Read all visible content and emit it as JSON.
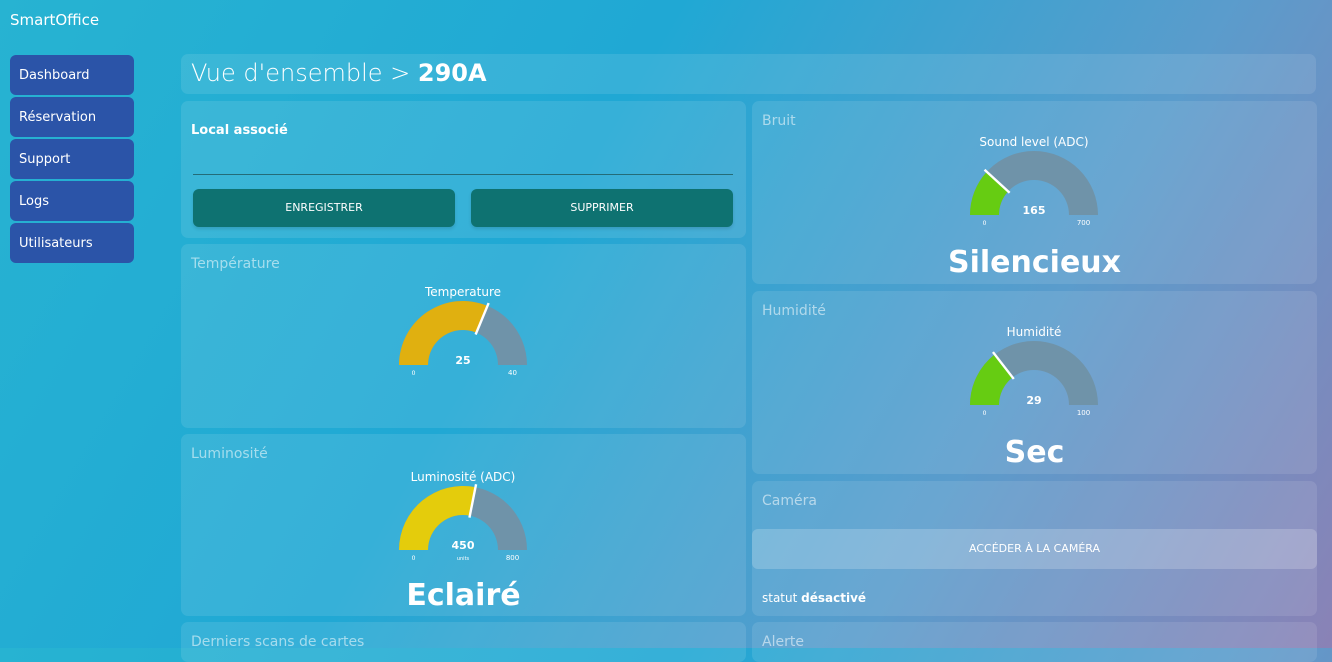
{
  "app": {
    "brand": "SmartOffice"
  },
  "sidebar": {
    "items": [
      {
        "label": "Dashboard"
      },
      {
        "label": "Réservation"
      },
      {
        "label": "Support"
      },
      {
        "label": "Logs"
      },
      {
        "label": "Utilisateurs"
      }
    ]
  },
  "header": {
    "prefix": "Vue d'ensemble >",
    "room": "290A"
  },
  "local": {
    "label": "Local associé",
    "value": "",
    "save_label": "ENREGISTRER",
    "delete_label": "SUPPRIMER"
  },
  "temperature": {
    "panel_title": "Température",
    "gauge": {
      "title": "Temperature",
      "value": 25,
      "min": 0,
      "max": 40,
      "min_label": "0",
      "max_label": "40",
      "units": "",
      "color": "#e0b010"
    }
  },
  "luminosite": {
    "panel_title": "Luminosité",
    "gauge": {
      "title": "Luminosité (ADC)",
      "value": 450,
      "min": 0,
      "max": 800,
      "min_label": "0",
      "max_label": "800",
      "units": "units",
      "color": "#e4cc0c"
    },
    "status": "Eclairé"
  },
  "derniers_scans": {
    "panel_title": "Derniers scans de cartes"
  },
  "bruit": {
    "panel_title": "Bruit",
    "gauge": {
      "title": "Sound level (ADC)",
      "value": 165,
      "min": 0,
      "max": 700,
      "min_label": "0",
      "max_label": "700",
      "units": "",
      "color": "#66cc12"
    },
    "status": "Silencieux"
  },
  "humidite": {
    "panel_title": "Humidité",
    "gauge": {
      "title": "Humidité",
      "value": 29,
      "min": 0,
      "max": 100,
      "min_label": "0",
      "max_label": "100",
      "units": "",
      "color": "#66cc12"
    },
    "status": "Sec"
  },
  "camera": {
    "panel_title": "Caméra",
    "button_label": "ACCÉDER À LA CAMÉRA",
    "status_label": "statut",
    "status_value": "désactivé"
  },
  "alerte": {
    "panel_title": "Alerte"
  }
}
